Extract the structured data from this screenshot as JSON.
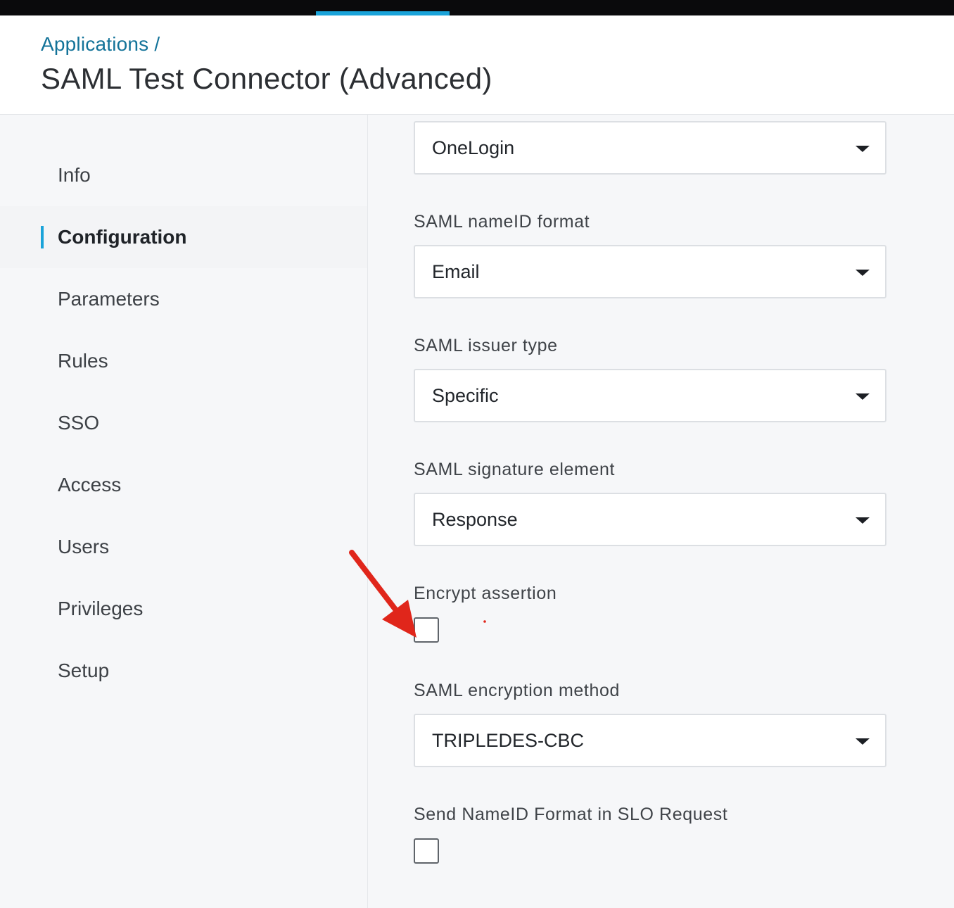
{
  "header": {
    "breadcrumb": "Applications /",
    "title": "SAML Test Connector (Advanced)"
  },
  "sidebar": {
    "items": [
      {
        "label": "Info",
        "active": false
      },
      {
        "label": "Configuration",
        "active": true
      },
      {
        "label": "Parameters",
        "active": false
      },
      {
        "label": "Rules",
        "active": false
      },
      {
        "label": "SSO",
        "active": false
      },
      {
        "label": "Access",
        "active": false
      },
      {
        "label": "Users",
        "active": false
      },
      {
        "label": "Privileges",
        "active": false
      },
      {
        "label": "Setup",
        "active": false
      }
    ]
  },
  "form": {
    "top_select_value": "OneLogin",
    "nameid_format": {
      "label": "SAML nameID format",
      "value": "Email"
    },
    "issuer_type": {
      "label": "SAML issuer type",
      "value": "Specific"
    },
    "signature_element": {
      "label": "SAML signature element",
      "value": "Response"
    },
    "encrypt_assertion": {
      "label": "Encrypt assertion",
      "checked": false
    },
    "encryption_method": {
      "label": "SAML encryption method",
      "value": "TRIPLEDES-CBC"
    },
    "send_nameid_format": {
      "label": "Send NameID Format in SLO Request",
      "checked": false
    }
  },
  "colors": {
    "accent": "#1aa3d9",
    "link": "#137399",
    "annotation_arrow": "#e0261b"
  },
  "icons": {
    "select_caret": "caret-down-icon",
    "annotation": "red-arrow-annotation"
  }
}
